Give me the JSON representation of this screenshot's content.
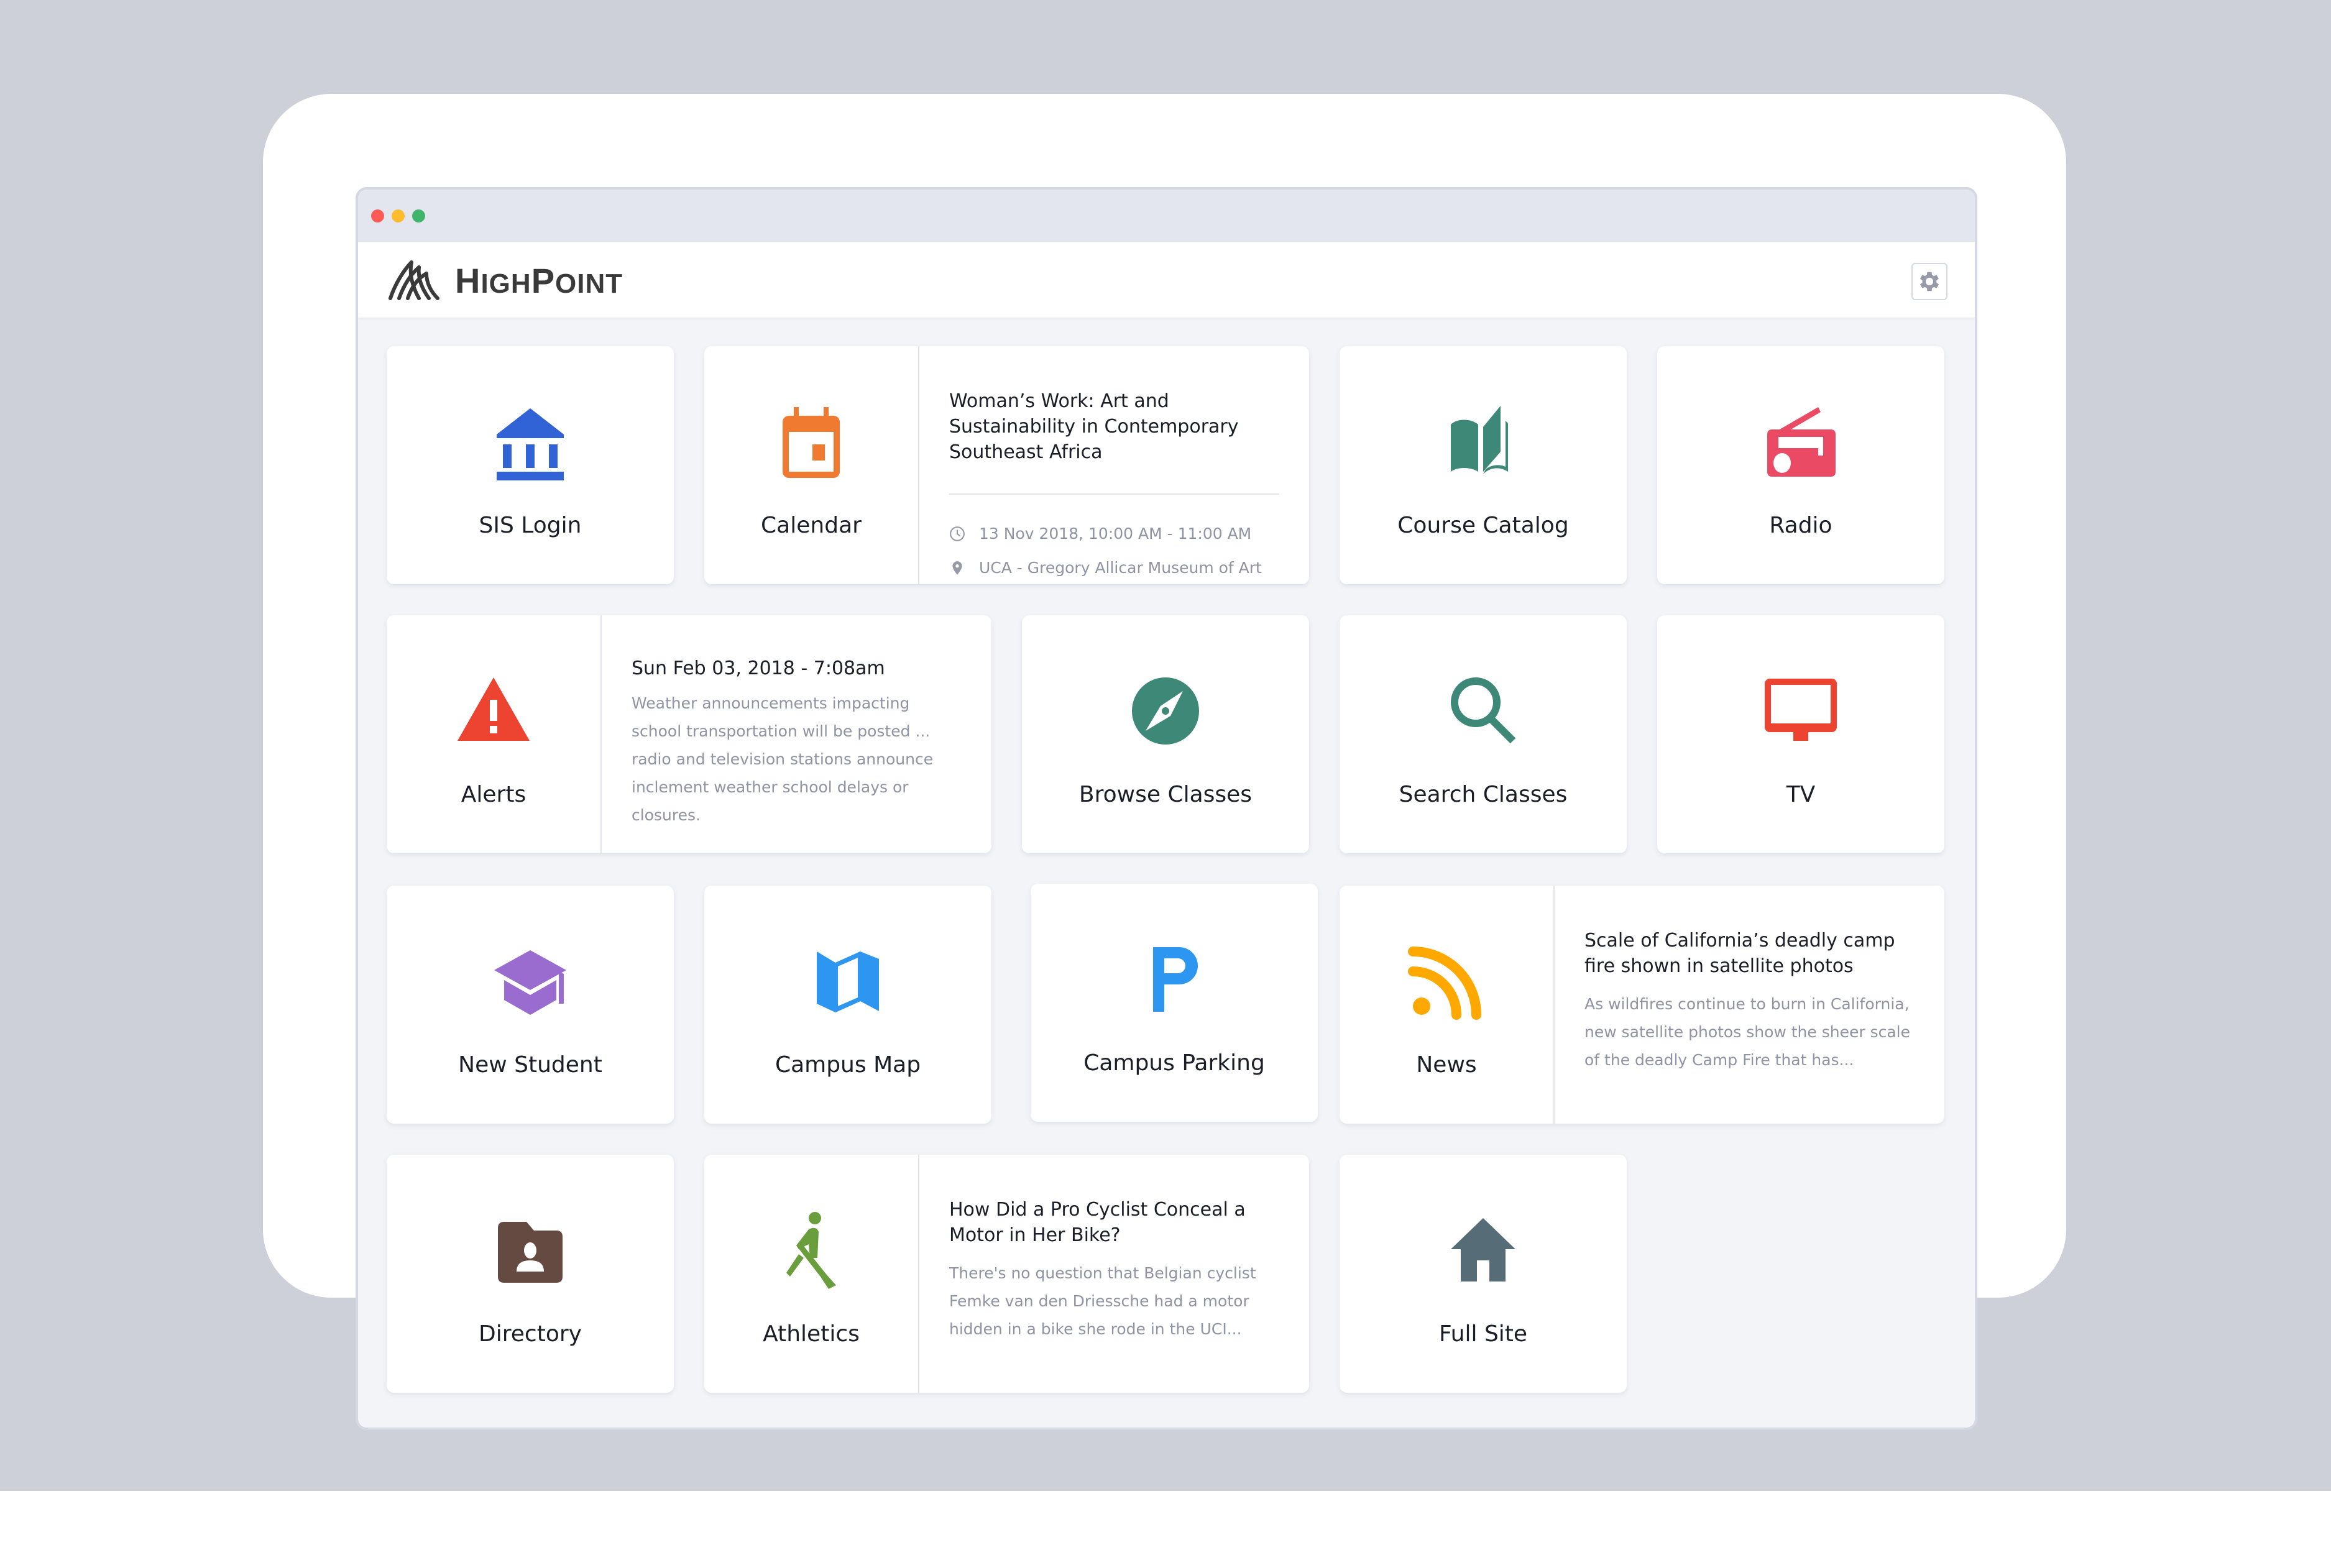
{
  "window": {
    "controls": [
      "close",
      "minimize",
      "maximize"
    ]
  },
  "header": {
    "brand": "HighPoint",
    "brand_initial_1": "H",
    "brand_rest_1": "IGH",
    "brand_initial_2": "P",
    "brand_rest_2": "OINT",
    "settings_icon": "gear-icon"
  },
  "colors": {
    "sis": "#3163d6",
    "calendar": "#f07b30",
    "course_catalog": "#3d8877",
    "radio": "#ea4a64",
    "alerts": "#ec4431",
    "browse": "#3d8877",
    "search": "#3d8877",
    "tv": "#ec4431",
    "new_student": "#9a6cd0",
    "campus_map": "#2d96f0",
    "campus_parking": "#2d96f0",
    "news": "#ffa800",
    "directory": "#644a41",
    "athletics": "#6a9e3c",
    "full_site": "#566c76"
  },
  "tiles": {
    "sis_login": {
      "label": "SIS Login",
      "icon": "bank-icon"
    },
    "calendar": {
      "label": "Calendar",
      "icon": "calendar-icon",
      "event": {
        "title": "Woman’s Work: Art and Sustainability in Contemporary Southeast Africa",
        "time": "13 Nov 2018, 10:00 AM - 11:00 AM",
        "location": "UCA - Gregory Allicar Museum of Art"
      }
    },
    "course_catalog": {
      "label": "Course Catalog",
      "icon": "book-icon"
    },
    "radio": {
      "label": "Radio",
      "icon": "radio-icon"
    },
    "alerts": {
      "label": "Alerts",
      "icon": "warning-icon",
      "alert": {
        "date": "Sun Feb 03, 2018 - 7:08am",
        "body": "Weather announcements impacting school transportation will be posted ... radio and television stations announce inclement weather school delays or closures."
      }
    },
    "browse_classes": {
      "label": "Browse Classes",
      "icon": "compass-icon"
    },
    "search_classes": {
      "label": "Search Classes",
      "icon": "search-icon"
    },
    "tv": {
      "label": "TV",
      "icon": "tv-icon"
    },
    "new_student": {
      "label": "New Student",
      "icon": "graduation-cap-icon"
    },
    "campus_map": {
      "label": "Campus Map",
      "icon": "map-icon"
    },
    "campus_parking": {
      "label": "Campus Parking",
      "icon": "parking-icon"
    },
    "news": {
      "label": "News",
      "icon": "rss-icon",
      "article": {
        "title": "Scale of California’s deadly camp fire shown in satellite photos",
        "body": "As wildfires continue to burn in California, new satellite photos show the sheer scale of the deadly Camp Fire that has..."
      }
    },
    "directory": {
      "label": "Directory",
      "icon": "contacts-folder-icon"
    },
    "athletics": {
      "label": "Athletics",
      "icon": "rowing-icon",
      "article": {
        "title": "How Did a Pro Cyclist Conceal a Motor in Her Bike?",
        "body": "There's no question that Belgian cyclist Femke van den Driessche had a motor hidden in a bike she rode in the UCI..."
      }
    },
    "full_site": {
      "label": "Full Site",
      "icon": "home-icon"
    }
  }
}
